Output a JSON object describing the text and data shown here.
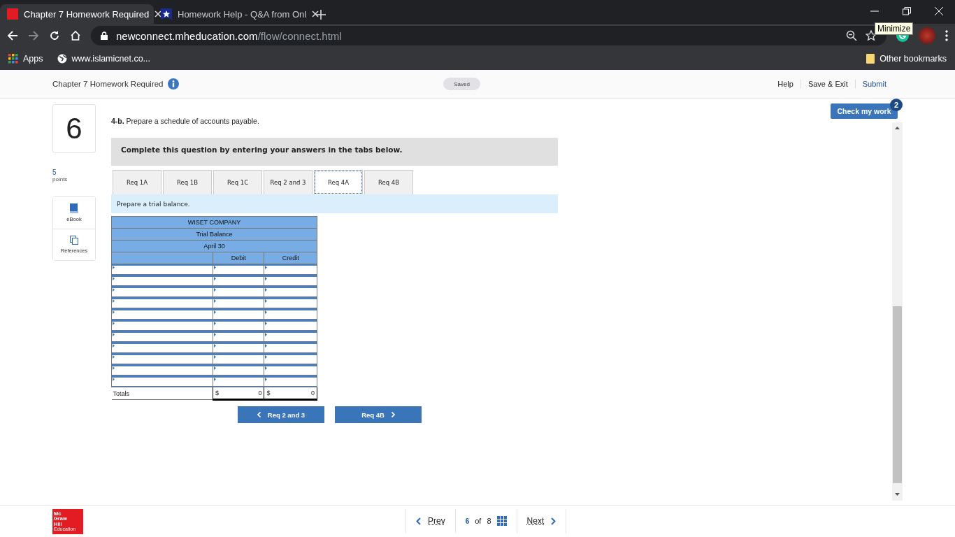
{
  "browser": {
    "tabs": [
      {
        "title": "Chapter 7 Homework Required",
        "selected": true
      },
      {
        "title": "Homework Help - Q&A from Onl",
        "selected": false
      }
    ],
    "url_host": "newconnect.mheducation.com",
    "url_path": "/flow/connect.html",
    "bookmarks": [
      {
        "label": "Apps",
        "kind": "apps"
      },
      {
        "label": "www.islamicnet.co...",
        "kind": "globe"
      }
    ],
    "other_bookmarks": "Other bookmarks",
    "tooltip": "Minimize"
  },
  "header": {
    "title": "Chapter 7 Homework Required",
    "status": "Saved",
    "links": [
      {
        "label": "Help",
        "kind": "plain"
      },
      {
        "label": "Save & Exit",
        "kind": "plain"
      },
      {
        "label": "Submit",
        "kind": "primary"
      }
    ]
  },
  "question": {
    "number": "6",
    "points": "5",
    "points_label": "points",
    "tools": [
      {
        "label": "eBook",
        "kind": "book"
      },
      {
        "label": "References",
        "kind": "copy"
      }
    ]
  },
  "check_button": {
    "label": "Check my work",
    "badge": "2"
  },
  "instruction": "**4-b.** Prepare a schedule of accounts payable.",
  "banner": "Complete this question by entering your answers in the tabs below.",
  "req_tabs": [
    {
      "label": "Req 1A",
      "selected": false
    },
    {
      "label": "Req 1B",
      "selected": false
    },
    {
      "label": "Req 1C",
      "selected": false
    },
    {
      "label": "Req 2 and 3",
      "selected": false
    },
    {
      "label": "Req 4A",
      "selected": true
    },
    {
      "label": "Req 4B",
      "selected": false
    }
  ],
  "tab_prompt": "Prepare a trial balance.",
  "table": {
    "title": "WISET COMPANY",
    "subtitle": "Trial Balance",
    "date": "April 30",
    "columns": [
      "Debit",
      "Credit"
    ],
    "rows": [
      {
        "kind": "input"
      },
      {
        "kind": "input"
      },
      {
        "kind": "input"
      },
      {
        "kind": "input"
      },
      {
        "kind": "input"
      },
      {
        "kind": "input"
      },
      {
        "kind": "input"
      },
      {
        "kind": "input"
      },
      {
        "kind": "input"
      },
      {
        "kind": "input"
      },
      {
        "kind": "input"
      },
      {
        "kind": "total",
        "label": "Totals",
        "debit_prefix": "$",
        "debit": "0",
        "credit_prefix": "$",
        "credit": "0"
      }
    ]
  },
  "nav": {
    "prev": "Req 2 and 3",
    "next": "Req 4B"
  },
  "footer": {
    "logo": [
      "Mc",
      "Graw",
      "Hill",
      "Education"
    ],
    "prev": "Prev",
    "current": "6",
    "of": "of",
    "total": "8",
    "next": "Next"
  }
}
